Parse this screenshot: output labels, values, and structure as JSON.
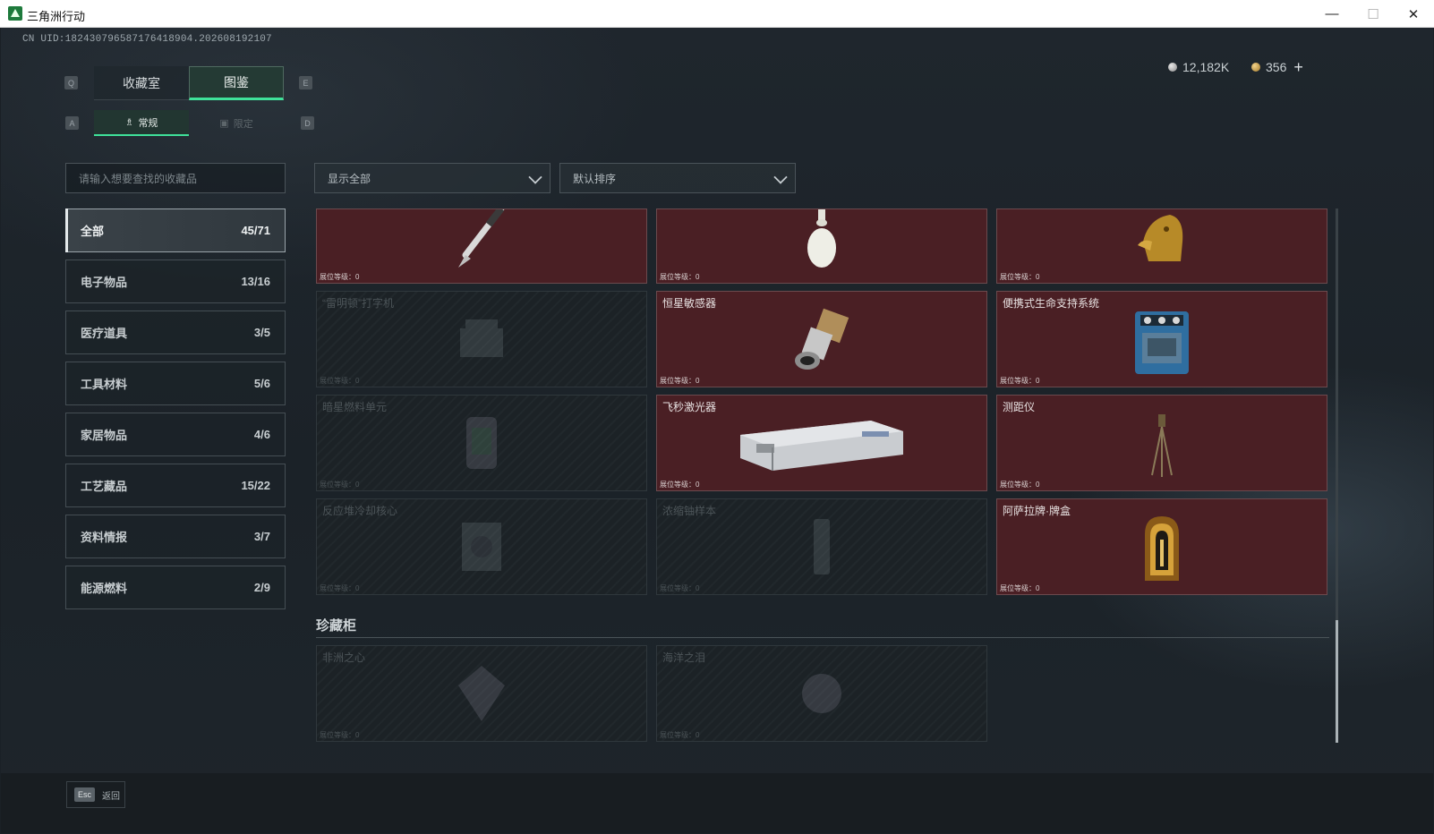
{
  "window": {
    "title": "三角洲行动",
    "minimize": "—",
    "maximize": "☐",
    "close": "✕"
  },
  "uid": "CN UID:182430796587176418904.202608192107",
  "currency": {
    "silver": "12,182K",
    "gold": "356",
    "add": "+"
  },
  "keys": {
    "q": "Q",
    "e": "E",
    "a": "A",
    "d": "D",
    "esc": "Esc"
  },
  "main_tabs": [
    "收藏室",
    "图鉴"
  ],
  "sub_tabs": [
    "常规",
    "限定"
  ],
  "search": {
    "placeholder": "请输入想要查找的收藏品"
  },
  "filters": {
    "show": "显示全部",
    "sort": "默认排序"
  },
  "categories": [
    {
      "label": "全部",
      "count": "45/71"
    },
    {
      "label": "电子物品",
      "count": "13/16"
    },
    {
      "label": "医疗道具",
      "count": "3/5"
    },
    {
      "label": "工具材料",
      "count": "5/6"
    },
    {
      "label": "家居物品",
      "count": "4/6"
    },
    {
      "label": "工艺藏品",
      "count": "15/22"
    },
    {
      "label": "资料情报",
      "count": "3/7"
    },
    {
      "label": "能源燃料",
      "count": "2/9"
    }
  ],
  "level_label": "展位等级：0",
  "items": [
    {
      "name": "",
      "icon": "fountain-pen-icon",
      "owned": true
    },
    {
      "name": "",
      "icon": "vase-icon",
      "owned": true
    },
    {
      "name": "",
      "icon": "golden-horse-head-icon",
      "owned": true
    },
    {
      "name": "“雷明顿”打字机",
      "icon": "typewriter-icon",
      "owned": false
    },
    {
      "name": "恒星敏感器",
      "icon": "star-sensor-icon",
      "owned": true
    },
    {
      "name": "便携式生命支持系统",
      "icon": "life-support-icon",
      "owned": true
    },
    {
      "name": "暗星燃料单元",
      "icon": "fuel-cell-icon",
      "owned": false
    },
    {
      "name": "飞秒激光器",
      "icon": "laser-box-icon",
      "owned": true
    },
    {
      "name": "测距仪",
      "icon": "tripod-icon",
      "owned": true
    },
    {
      "name": "反应堆冷却核心",
      "icon": "reactor-core-icon",
      "owned": false
    },
    {
      "name": "浓缩铀样本",
      "icon": "uranium-sample-icon",
      "owned": false
    },
    {
      "name": "阿萨拉牌·牌盒",
      "icon": "card-box-icon",
      "owned": true
    }
  ],
  "section_title": "珍藏柜",
  "cabinet": [
    {
      "name": "非洲之心",
      "icon": "gem-icon",
      "owned": false
    },
    {
      "name": "海洋之泪",
      "icon": "pearl-icon",
      "owned": false
    }
  ],
  "back_label": "返回"
}
